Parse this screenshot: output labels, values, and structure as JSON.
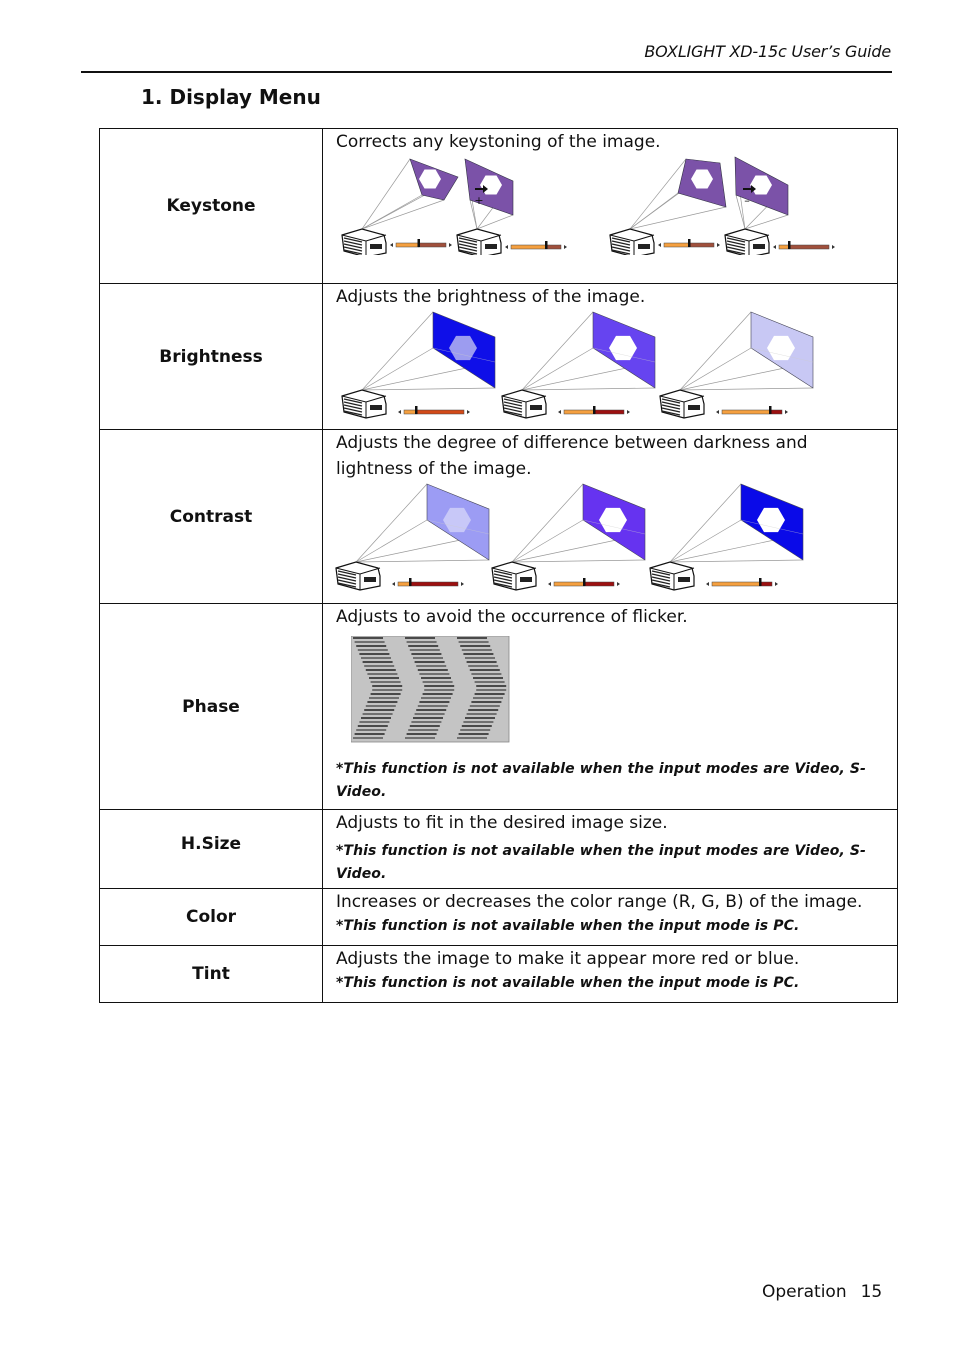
{
  "header": {
    "title": "BOXLIGHT XD-15c User’s Guide"
  },
  "section": {
    "title": "1. Display Menu"
  },
  "rows": [
    {
      "label": "Keystone",
      "description": "Corrects any keystoning of the image.",
      "illustration": {
        "type": "keystone",
        "groups": [
          {
            "operator": "+",
            "from_slider": 0.45,
            "to_slider": 0.7
          },
          {
            "operator": "–",
            "from_slider": 0.5,
            "to_slider": 0.2
          }
        ],
        "screen_color": "#7b52a8"
      }
    },
    {
      "label": "Brightness",
      "description": "Adjusts the brightness of the image.",
      "illustration": {
        "type": "brightness",
        "levels": [
          {
            "screen_color": "#0f0fe8",
            "hexagon_color": "#9c9cf0",
            "slider": 0.2
          },
          {
            "screen_color": "#6644f0",
            "hexagon_color": "#ffffff",
            "slider": 0.5
          },
          {
            "screen_color": "#c8c8f4",
            "hexagon_color": "#ffffff",
            "slider": 0.8
          }
        ]
      }
    },
    {
      "label": "Contrast",
      "description": "Adjusts the degree of difference between darkness and lightness of the image.",
      "illustration": {
        "type": "contrast",
        "levels": [
          {
            "screen_color": "#9c9cf4",
            "hexagon_color": "#c8c8f8",
            "slider": 0.2
          },
          {
            "screen_color": "#6633f0",
            "hexagon_color": "#ffffff",
            "slider": 0.5
          },
          {
            "screen_color": "#0a0ae8",
            "hexagon_color": "#ffffff",
            "slider": 0.8
          }
        ]
      }
    },
    {
      "label": "Phase",
      "description": "Adjusts to avoid the occurrence of flicker.",
      "illustration": {
        "type": "phase-pattern",
        "background": "#c4c4c4"
      },
      "note": "*This function is not available when the input modes are Video, S-Video."
    },
    {
      "label": "H.Size",
      "description": "Adjusts to fit in the desired image size.",
      "note": "*This function is not available when the input modes are Video, S-Video."
    },
    {
      "label": "Color",
      "description": "Increases or decreases the color range (R, G, B) of the image.",
      "note": "*This function is not available when the input mode is PC."
    },
    {
      "label": "Tint",
      "description": "Adjusts  the image to make it appear more red or blue.",
      "note": "*This function is not available when the input mode is PC."
    }
  ],
  "footer": {
    "section": "Operation",
    "page": "15"
  }
}
